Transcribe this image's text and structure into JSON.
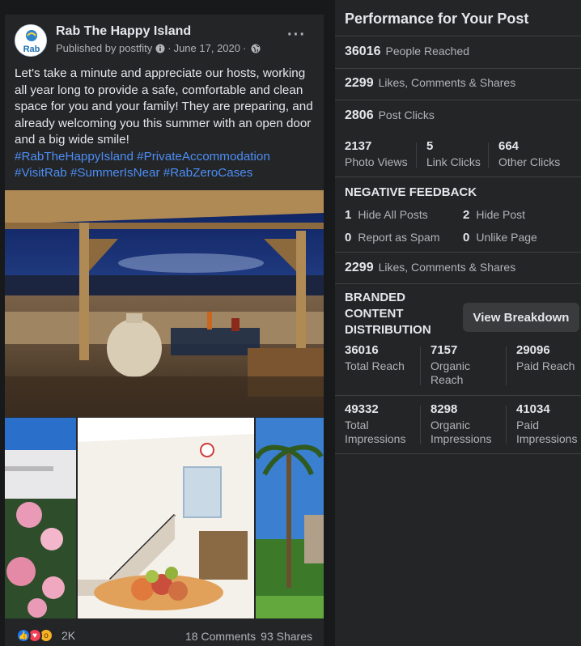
{
  "post": {
    "page_name": "Rab The Happy Island",
    "avatar_text": "Rab",
    "published_prefix": "Published by postfity",
    "date": "June 17, 2020",
    "more_icon": "more-horizontal-icon",
    "text": "Let's take a minute and appreciate our hosts, working all year long to provide a safe, comfortable and clean space for you and your family! They are preparing, and already welcoming you this summer with an open door and a big wide smile!",
    "hashtags": [
      "#RabTheHappyIsland",
      "#PrivateAccommodation",
      "#VisitRab",
      "#SummerIsNear",
      "#RabZeroCases"
    ],
    "reaction_count": "2K",
    "comments": "18 Comments",
    "shares": "93 Shares",
    "reactions": [
      "like-icon",
      "love-icon",
      "wow-icon"
    ]
  },
  "insights": {
    "title": "Performance for Your Post",
    "people_reached": {
      "value": "36016",
      "label": "People Reached"
    },
    "engagement": {
      "value": "2299",
      "label": "Likes, Comments & Shares"
    },
    "post_clicks": {
      "value": "2806",
      "label": "Post Clicks"
    },
    "clicks_breakdown": [
      {
        "value": "2137",
        "label": "Photo Views"
      },
      {
        "value": "5",
        "label": "Link Clicks"
      },
      {
        "value": "664",
        "label": "Other Clicks"
      }
    ],
    "negative_feedback": {
      "title": "NEGATIVE FEEDBACK",
      "items": [
        {
          "value": "1",
          "label": "Hide All Posts"
        },
        {
          "value": "2",
          "label": "Hide Post"
        },
        {
          "value": "0",
          "label": "Report as Spam"
        },
        {
          "value": "0",
          "label": "Unlike Page"
        }
      ]
    },
    "engagement_2": {
      "value": "2299",
      "label": "Likes, Comments & Shares"
    },
    "branded": {
      "title_lines": [
        "BRANDED",
        "CONTENT",
        "DISTRIBUTION"
      ],
      "button": "View Breakdown",
      "reach": [
        {
          "value": "36016",
          "label_lines": [
            "Total Reach"
          ]
        },
        {
          "value": "7157",
          "label_lines": [
            "Organic",
            "Reach"
          ]
        },
        {
          "value": "29096",
          "label_lines": [
            "Paid Reach"
          ]
        }
      ],
      "impressions": [
        {
          "value": "49332",
          "label_lines": [
            "Total",
            "Impressions"
          ]
        },
        {
          "value": "8298",
          "label_lines": [
            "Organic",
            "Impressions"
          ]
        },
        {
          "value": "41034",
          "label_lines": [
            "Paid",
            "Impressions"
          ]
        }
      ]
    }
  },
  "colors": {
    "background": "#18191a",
    "card": "#242526",
    "text_primary": "#e4e6eb",
    "text_secondary": "#b0b3b8",
    "hashtag": "#4c8ef7",
    "button": "#3a3b3c"
  }
}
